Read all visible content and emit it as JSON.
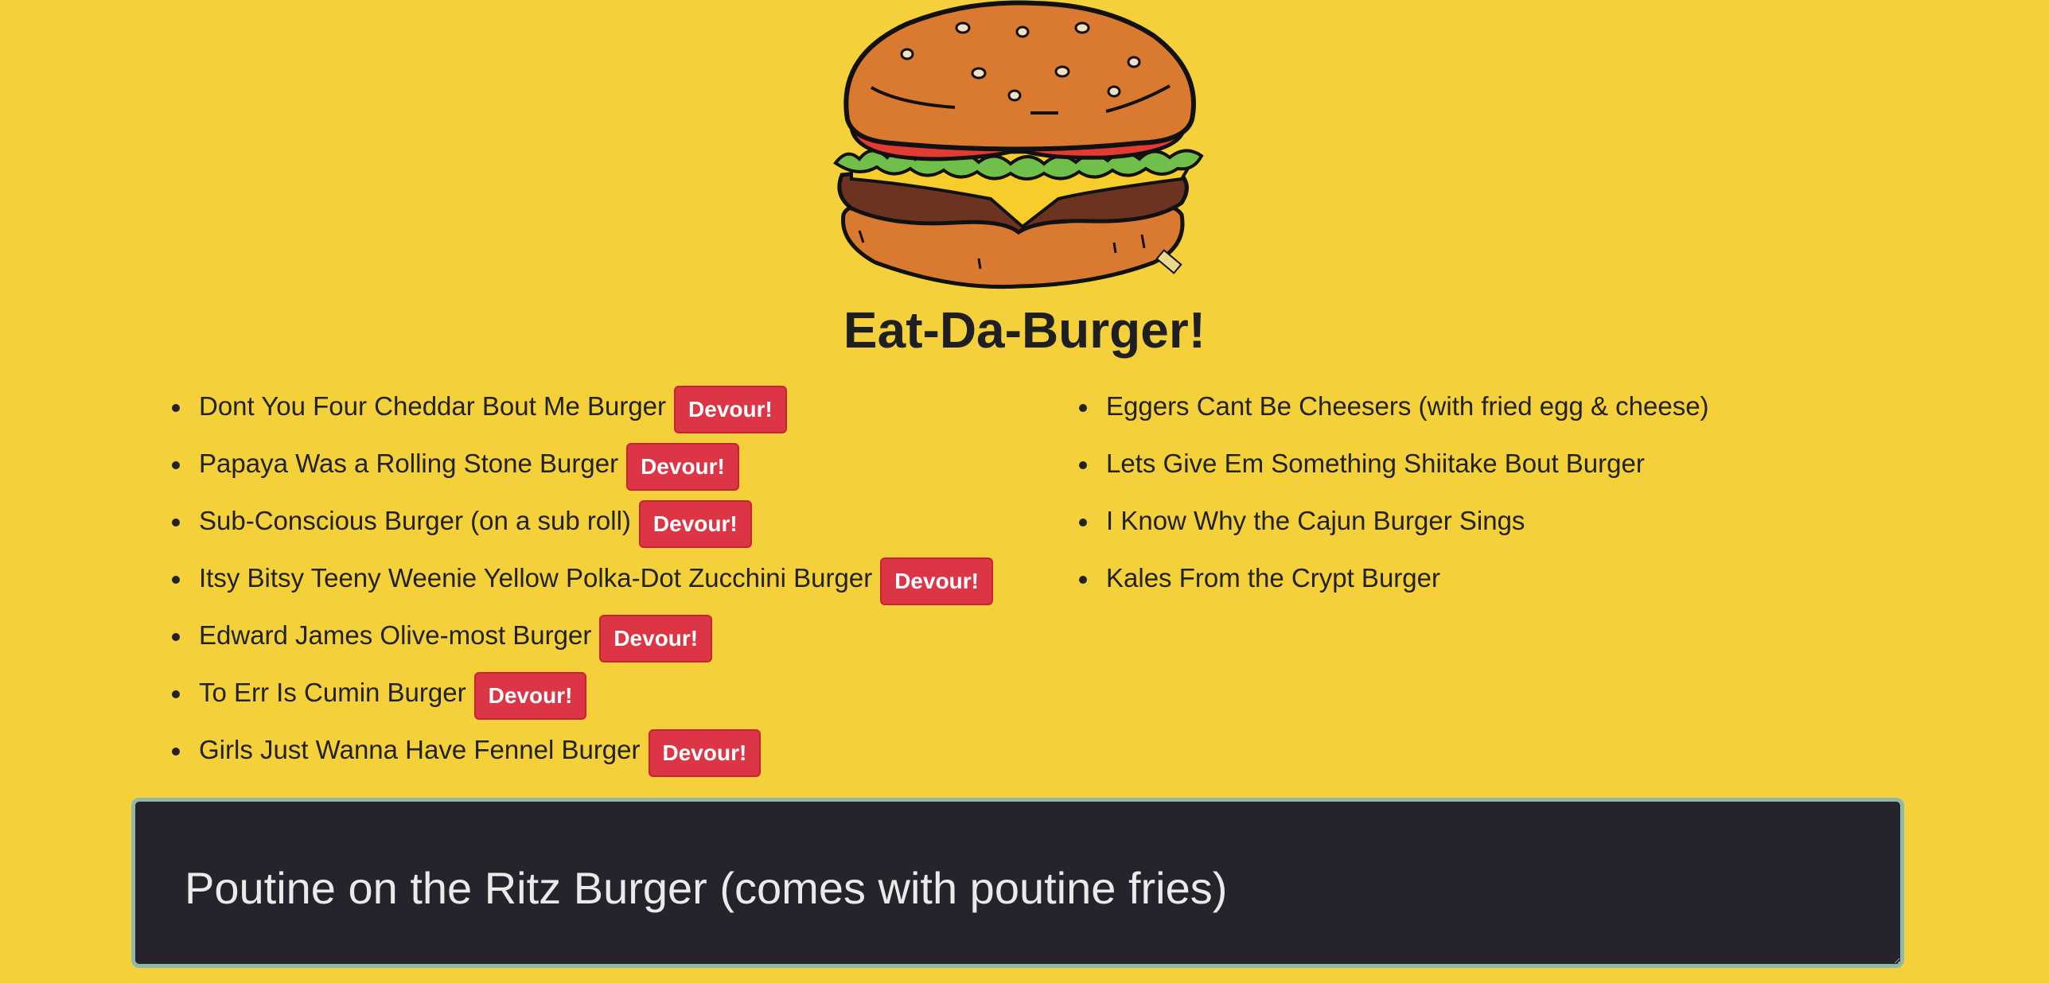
{
  "page": {
    "title": "Eat-Da-Burger!"
  },
  "uneaten": [
    {
      "name": "Dont You Four Cheddar Bout Me Burger",
      "button": "Devour!"
    },
    {
      "name": "Papaya Was a Rolling Stone Burger",
      "button": "Devour!"
    },
    {
      "name": "Sub-Conscious Burger (on a sub roll)",
      "button": "Devour!"
    },
    {
      "name": "Itsy Bitsy Teeny Weenie Yellow Polka-Dot Zucchini Burger",
      "button": "Devour!"
    },
    {
      "name": "Edward James Olive-most Burger",
      "button": "Devour!"
    },
    {
      "name": "To Err Is Cumin Burger",
      "button": "Devour!"
    },
    {
      "name": "Girls Just Wanna Have Fennel Burger",
      "button": "Devour!"
    }
  ],
  "devoured": [
    {
      "name": "Eggers Cant Be Cheesers (with fried egg & cheese)"
    },
    {
      "name": "Lets Give Em Something Shiitake Bout Burger"
    },
    {
      "name": "I Know Why the Cajun Burger Sings"
    },
    {
      "name": "Kales From the Crypt Burger"
    }
  ],
  "new_burger": {
    "value": "Poutine on the Ritz Burger (comes with poutine fries)"
  },
  "colors": {
    "background": "#f4d03a",
    "button": "#dc3545",
    "input_bg": "#25232b",
    "input_border": "#8fb8a8"
  },
  "icons": {
    "logo": "burger-icon"
  }
}
